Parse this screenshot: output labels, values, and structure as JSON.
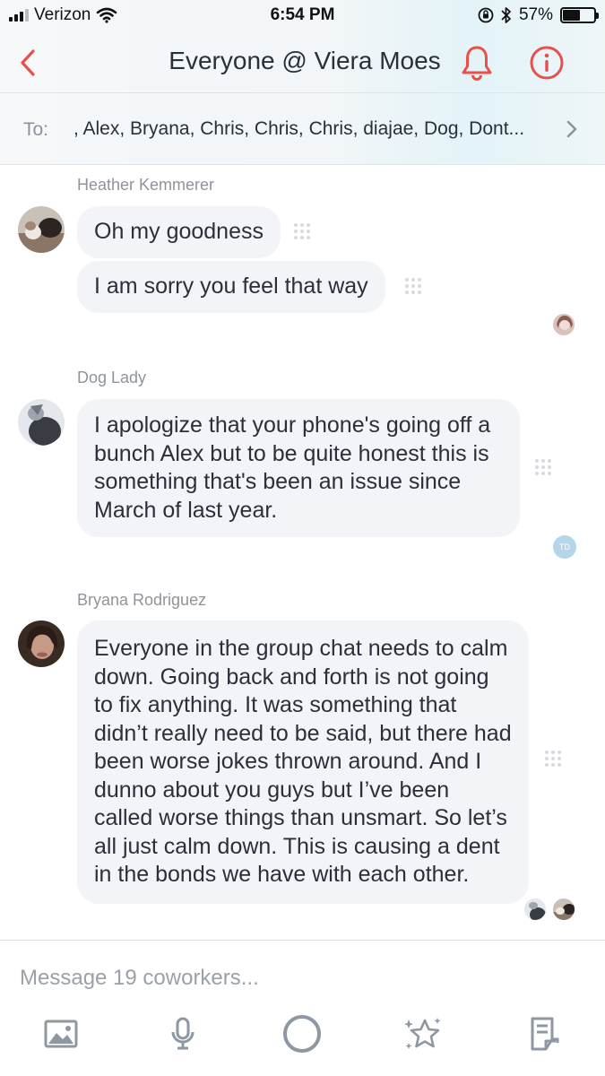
{
  "status_bar": {
    "carrier": "Verizon",
    "time": "6:54 PM",
    "battery": "57%",
    "battery_level": 0.57
  },
  "nav": {
    "title": "Everyone @ Viera Moes"
  },
  "recipients": {
    "label": "To:",
    "names": ", Alex, Bryana, Chris, Chris, Chris, diajae, Dog, Dont..."
  },
  "messages": [
    {
      "sender": "Heather Kemmerer",
      "bubbles": [
        "Oh my goodness",
        "I am sorry you feel that way"
      ]
    },
    {
      "sender": "Dog Lady",
      "bubbles": [
        "I apologize that your phone's going off a bunch Alex but to be quite honest this is something that's been an issue since March of last year."
      ],
      "read_receipt": "TD"
    },
    {
      "sender": "Bryana Rodriguez",
      "bubbles": [
        "Everyone in the group chat needs to calm down. Going back and forth is not going to fix anything. It was something that didn’t really need to be said, but there had been worse jokes thrown around. And I dunno about you guys but I’ve been called worse things than unsmart. So let’s all just calm down. This is causing a dent in the bonds we have with each other."
      ]
    }
  ],
  "composer": {
    "placeholder": "Message 19 coworkers..."
  },
  "colors": {
    "accent": "#e8514a",
    "bubble": "#f2f4f7",
    "icon_gray": "#8e97a2"
  },
  "icons": [
    "back-chevron-icon",
    "bell-icon",
    "info-icon",
    "chevron-right-icon",
    "image-icon",
    "microphone-icon",
    "circle-icon",
    "sparkle-star-icon",
    "notes-icon"
  ]
}
